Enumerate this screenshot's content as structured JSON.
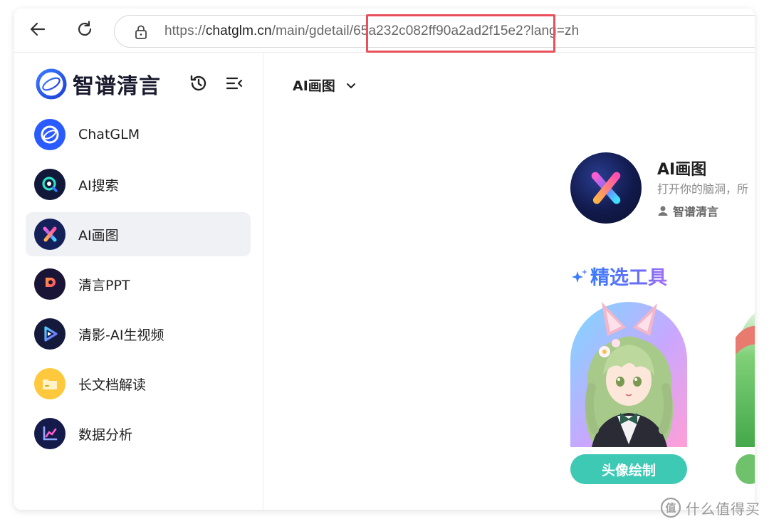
{
  "browser": {
    "url_prefix": "https://",
    "url_host": "chatglm.cn",
    "url_path": "/main/gdetail/65a232c082ff90a2ad2f15e2?lang=zh"
  },
  "sidebar": {
    "brand_name": "智谱清言",
    "items": [
      {
        "label": "ChatGLM",
        "icon": "chatglm-icon"
      },
      {
        "label": "AI搜索",
        "icon": "ai-search-icon"
      },
      {
        "label": "AI画图",
        "icon": "ai-draw-icon",
        "active": true
      },
      {
        "label": "清言PPT",
        "icon": "ppt-icon"
      },
      {
        "label": "清影-AI生视频",
        "icon": "video-icon"
      },
      {
        "label": "长文档解读",
        "icon": "folder-icon"
      },
      {
        "label": "数据分析",
        "icon": "chart-icon"
      }
    ]
  },
  "main": {
    "mode_label": "AI画图",
    "agent": {
      "title": "AI画图",
      "description": "打开你的脑洞，所",
      "author": "智谱清言"
    },
    "section_title": "精选工具",
    "tools": [
      {
        "label": "头像绘制"
      }
    ]
  },
  "watermark": "什么值得买",
  "colors": {
    "accent_teal": "#3ec9b5",
    "highlight_red": "#e8505b",
    "active_bg": "#f0f1f4"
  }
}
